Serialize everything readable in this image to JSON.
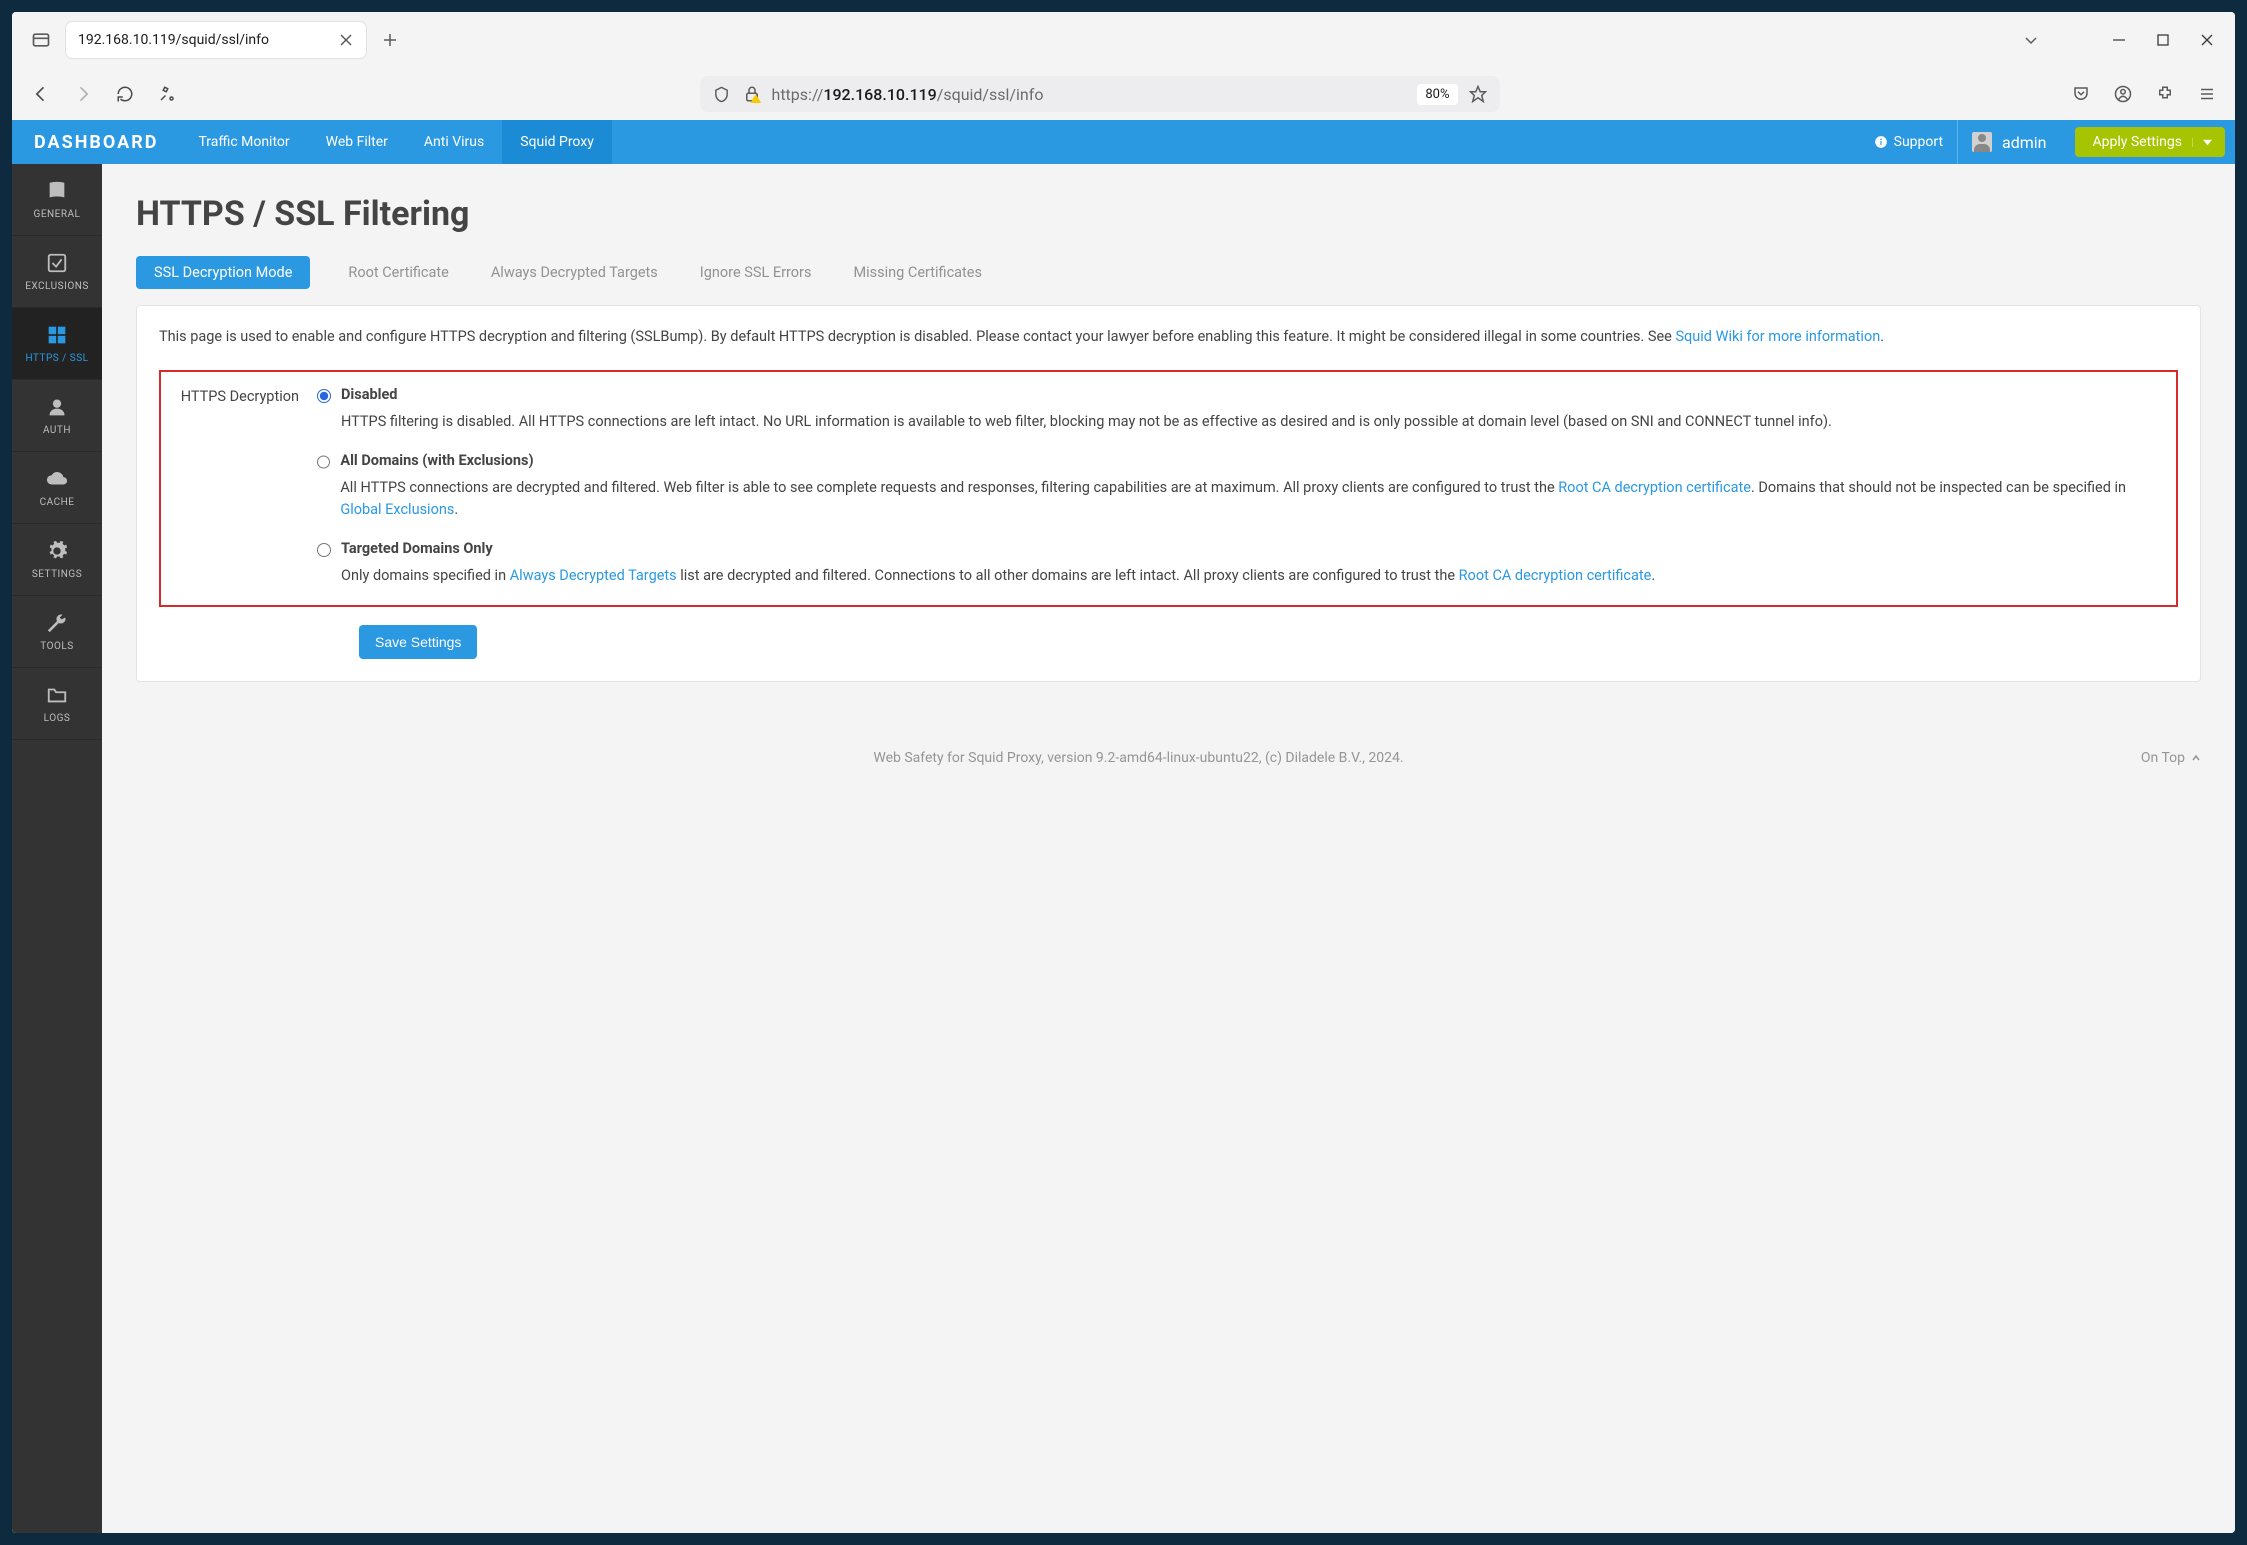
{
  "browser": {
    "tab_title": "192.168.10.119/squid/ssl/info",
    "url_prefix": "https://",
    "url_host": "192.168.10.119",
    "url_path": "/squid/ssl/info",
    "zoom": "80%"
  },
  "topbar": {
    "brand": "DASHBOARD",
    "links": [
      {
        "label": "Traffic Monitor",
        "active": false
      },
      {
        "label": "Web Filter",
        "active": false
      },
      {
        "label": "Anti Virus",
        "active": false
      },
      {
        "label": "Squid Proxy",
        "active": true
      }
    ],
    "support_label": "Support",
    "user_label": "admin",
    "apply_label": "Apply Settings"
  },
  "sidebar": [
    {
      "label": "GENERAL",
      "icon": "book-icon",
      "active": false
    },
    {
      "label": "EXCLUSIONS",
      "icon": "check-square-icon",
      "active": false
    },
    {
      "label": "HTTPS / SSL",
      "icon": "grid-icon",
      "active": true
    },
    {
      "label": "AUTH",
      "icon": "user-icon",
      "active": false
    },
    {
      "label": "CACHE",
      "icon": "cloud-icon",
      "active": false
    },
    {
      "label": "SETTINGS",
      "icon": "gear-icon",
      "active": false
    },
    {
      "label": "TOOLS",
      "icon": "wrench-icon",
      "active": false
    },
    {
      "label": "LOGS",
      "icon": "folder-icon",
      "active": false
    }
  ],
  "page": {
    "title": "HTTPS / SSL Filtering",
    "subtabs": [
      {
        "label": "SSL Decryption Mode",
        "active": true
      },
      {
        "label": "Root Certificate",
        "active": false
      },
      {
        "label": "Always Decrypted Targets",
        "active": false
      },
      {
        "label": "Ignore SSL Errors",
        "active": false
      },
      {
        "label": "Missing Certificates",
        "active": false
      }
    ],
    "intro_pre": "This page is used to enable and configure HTTPS decryption and filtering (SSLBump). By default HTTPS decryption is disabled. Please contact your lawyer before enabling this feature. It might be considered illegal in some countries. See ",
    "intro_link": "Squid Wiki for more information",
    "intro_post": ".",
    "form_label": "HTTPS Decryption",
    "options": {
      "disabled": {
        "title": "Disabled",
        "desc": "HTTPS filtering is disabled. All HTTPS connections are left intact. No URL information is available to web filter, blocking may not be as effective as desired and is only possible at domain level (based on SNI and CONNECT tunnel info)."
      },
      "all": {
        "title": "All Domains (with Exclusions)",
        "d1": "All HTTPS connections are decrypted and filtered. Web filter is able to see complete requests and responses, filtering capabilities are at maximum. All proxy clients are configured to trust the ",
        "link1": "Root CA decryption certificate",
        "d2": ". Domains that should not be inspected can be specified in ",
        "link2": "Global Exclusions",
        "tail": "."
      },
      "targeted": {
        "title": "Targeted Domains Only",
        "d1": "Only domains specified in ",
        "link1": "Always Decrypted Targets",
        "d2": " list are decrypted and filtered. Connections to all other domains are left intact. All proxy clients are configured to trust the ",
        "link2": "Root CA decryption certificate",
        "tail": "."
      }
    },
    "save_label": "Save Settings",
    "footer_text": "Web Safety for Squid Proxy, version 9.2-amd64-linux-ubuntu22, (c) Diladele B.V., 2024.",
    "ontop_label": "On Top"
  },
  "colors": {
    "primary": "#2a99e2",
    "accent": "#a6c500",
    "danger": "#d52c29"
  }
}
